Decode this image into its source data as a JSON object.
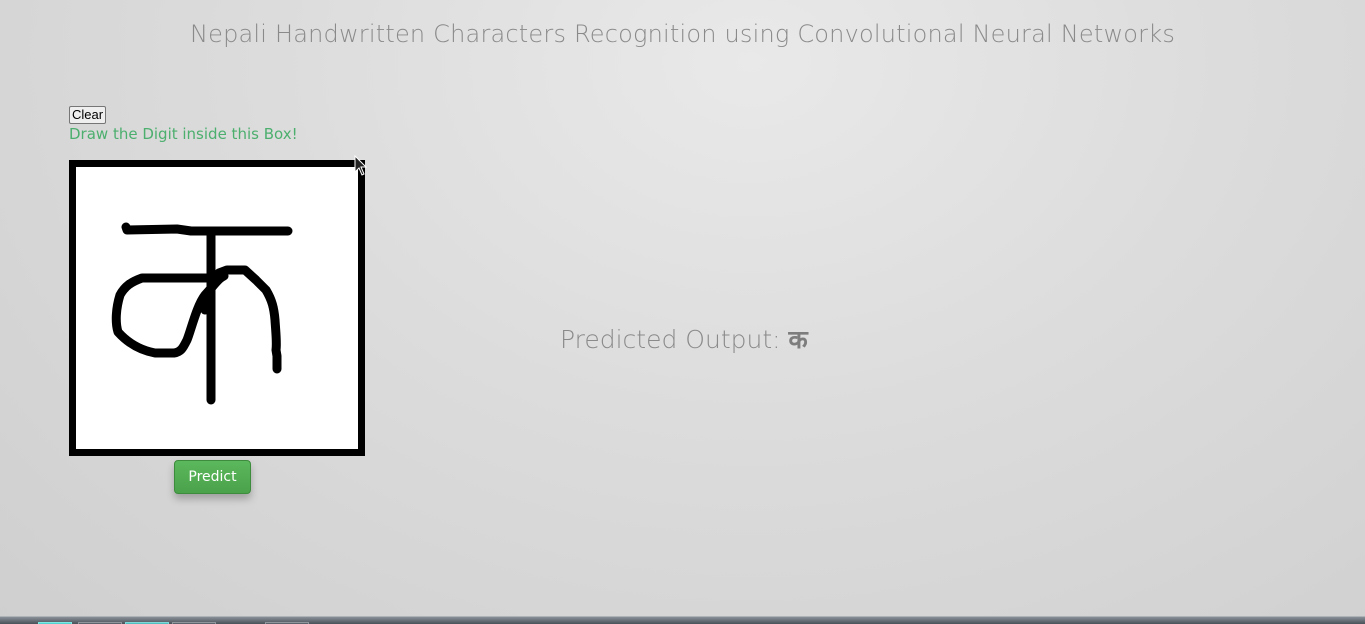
{
  "header": {
    "title": "Nepali Handwritten Characters Recognition using Convolutional Neural Networks"
  },
  "controls": {
    "clear_label": "Clear",
    "instruction": "Draw the Digit inside this Box!",
    "predict_label": "Predict"
  },
  "drawing": {
    "character": "क"
  },
  "result": {
    "label": "Predicted Output: ",
    "value": "क"
  },
  "colors": {
    "instruction_text": "#4caf6e",
    "predict_button": "#5cb85c",
    "canvas_border": "#000000",
    "canvas_background": "#ffffff"
  }
}
